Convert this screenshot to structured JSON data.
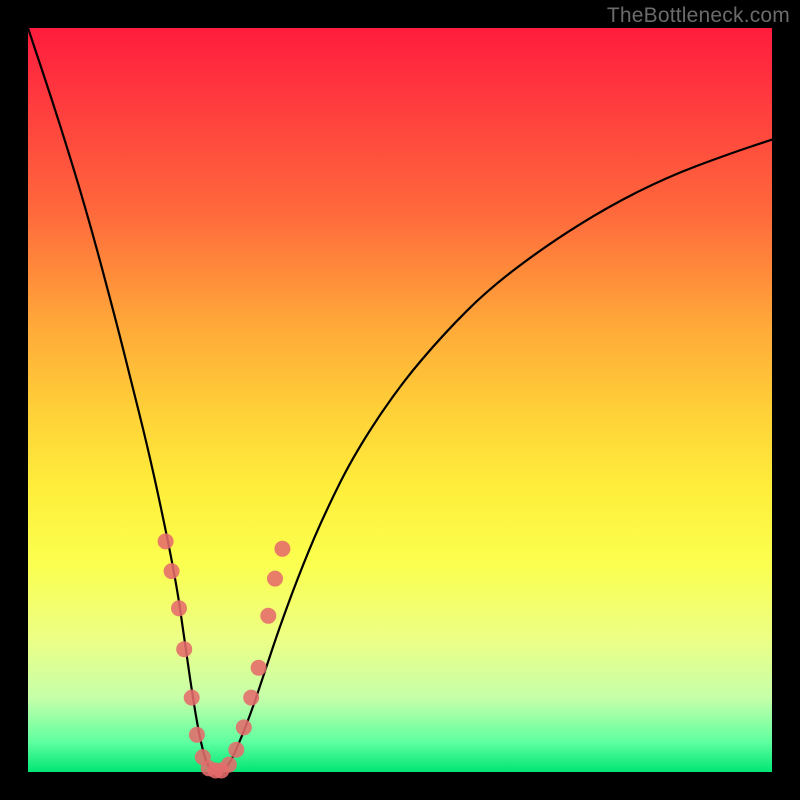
{
  "watermark": "TheBottleneck.com",
  "chart_data": {
    "type": "line",
    "title": "",
    "xlabel": "",
    "ylabel": "",
    "xlim": [
      0,
      100
    ],
    "ylim": [
      0,
      100
    ],
    "series": [
      {
        "name": "bottleneck-curve",
        "x": [
          0,
          4,
          8,
          12,
          14,
          16,
          18,
          20,
          21,
          22,
          23,
          24,
          25,
          26,
          27,
          28,
          30,
          32,
          34,
          37,
          40,
          44,
          50,
          56,
          62,
          70,
          78,
          86,
          94,
          100
        ],
        "values": [
          100,
          88,
          75,
          60,
          52,
          44,
          35,
          25,
          18,
          11,
          5,
          1,
          0,
          0,
          1,
          3,
          8,
          14,
          20,
          28,
          35,
          43,
          52,
          59,
          65,
          71,
          76,
          80,
          83,
          85
        ]
      }
    ],
    "markers": {
      "name": "highlighted-points",
      "color": "#e56b6b",
      "radius": 8,
      "x": [
        18.5,
        19.3,
        20.3,
        21.0,
        22.0,
        22.7,
        23.5,
        24.3,
        25.2,
        26.0,
        27.0,
        28.0,
        29.0,
        30.0,
        31.0,
        32.3,
        33.2,
        34.2
      ],
      "values": [
        31.0,
        27.0,
        22.0,
        16.5,
        10.0,
        5.0,
        2.0,
        0.5,
        0.2,
        0.2,
        1.0,
        3.0,
        6.0,
        10.0,
        14.0,
        21.0,
        26.0,
        30.0
      ]
    },
    "background_gradient": {
      "top": "#ff1c3e",
      "mid": "#ffee3b",
      "bottom": "#00e574"
    }
  }
}
